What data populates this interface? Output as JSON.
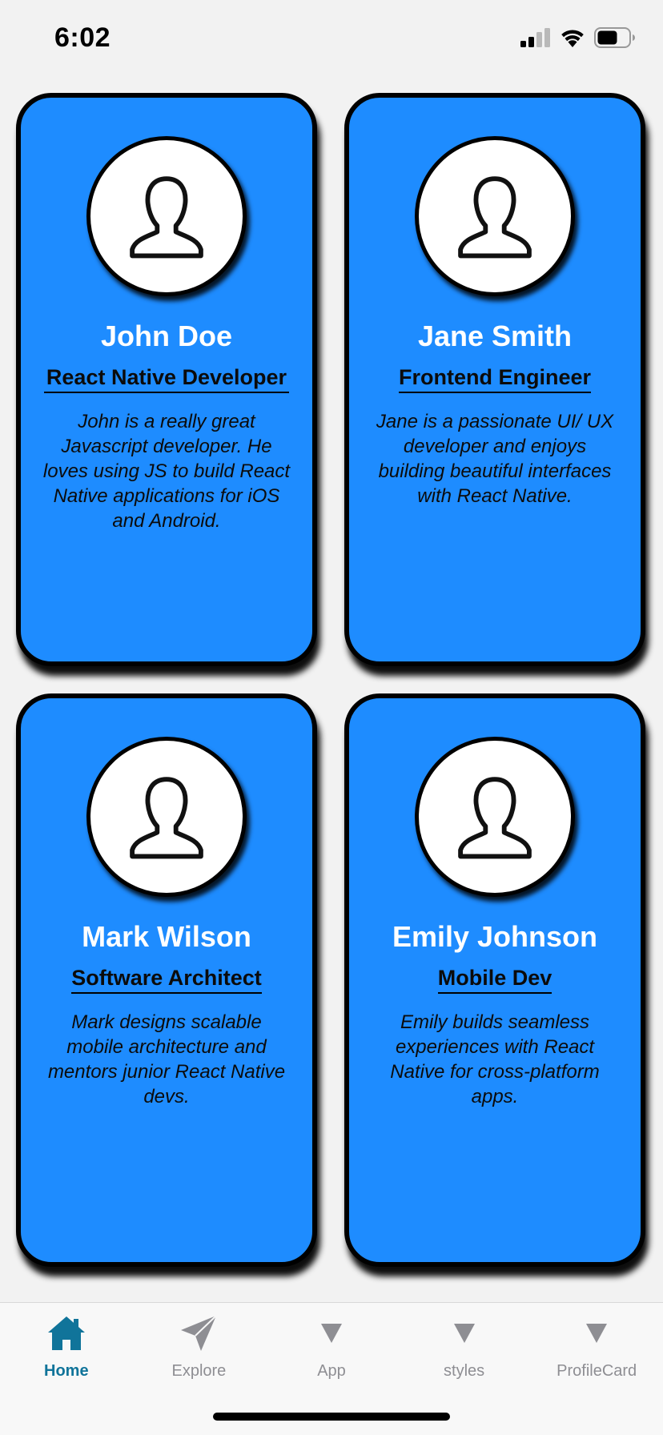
{
  "status_bar": {
    "time": "6:02"
  },
  "cards": [
    {
      "name": "John Doe",
      "role": "React Native Developer",
      "bio": "John is a really great Javascript developer. He loves using JS to build React Native applications for iOS and Android."
    },
    {
      "name": "Jane Smith",
      "role": "Frontend Engineer",
      "bio": "Jane is a passionate UI/ UX developer and enjoys building beautiful interfaces with React Native."
    },
    {
      "name": "Mark Wilson",
      "role": "Software Architect",
      "bio": "Mark designs scalable mobile architecture and mentors junior React Native devs."
    },
    {
      "name": "Emily Johnson",
      "role": "Mobile Dev",
      "bio": "Emily builds seamless experiences with React Native for cross-platform apps."
    }
  ],
  "tab_bar": {
    "tabs": [
      {
        "label": "Home",
        "icon": "home-icon",
        "active": true
      },
      {
        "label": "Explore",
        "icon": "paper-plane-icon",
        "active": false
      },
      {
        "label": "App",
        "icon": "triangle-down-icon",
        "active": false
      },
      {
        "label": "styles",
        "icon": "triangle-down-icon",
        "active": false
      },
      {
        "label": "ProfileCard",
        "icon": "triangle-down-icon",
        "active": false
      }
    ]
  },
  "colors": {
    "card_background": "#1e8cff",
    "active_tab": "#10749a",
    "inactive_tab": "#8e8e93",
    "screen_background": "#f2f2f2"
  }
}
